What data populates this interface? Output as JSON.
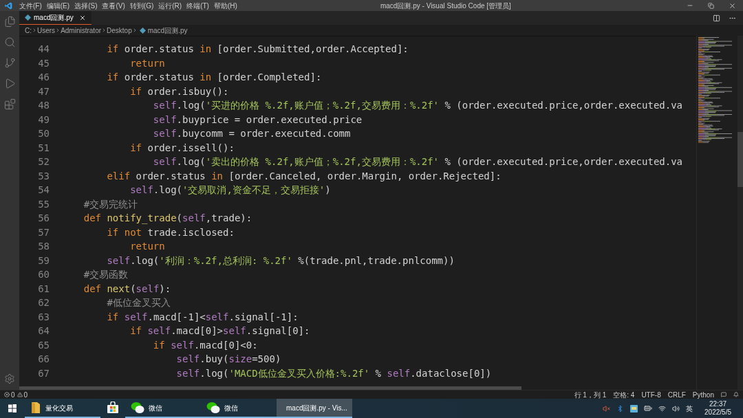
{
  "window": {
    "title": "macd回测.py - Visual Studio Code [管理员]"
  },
  "menu": [
    "文件(F)",
    "编辑(E)",
    "选择(S)",
    "查看(V)",
    "转到(G)",
    "运行(R)",
    "终端(T)",
    "帮助(H)"
  ],
  "tabs": [
    {
      "label": "macd回测.py",
      "selected": true
    }
  ],
  "breadcrumb": [
    "C:",
    "Users",
    "Administrator",
    "Desktop",
    "macd回测.py"
  ],
  "code": {
    "lines": [
      {
        "number": "44",
        "tokens": [
          {
            "kind": "keyword",
            "text": "        if"
          },
          {
            "kind": "plain",
            "text": " order.status "
          },
          {
            "kind": "keyword",
            "text": "in"
          },
          {
            "kind": "plain",
            "text": " [order.Submitted,order.Accepted]:"
          }
        ]
      },
      {
        "number": "45",
        "tokens": [
          {
            "kind": "keyword",
            "text": "            return"
          }
        ]
      },
      {
        "number": "46",
        "tokens": [
          {
            "kind": "keyword",
            "text": "        if"
          },
          {
            "kind": "plain",
            "text": " order.status "
          },
          {
            "kind": "keyword",
            "text": "in"
          },
          {
            "kind": "plain",
            "text": " [order.Completed]:"
          }
        ]
      },
      {
        "number": "47",
        "tokens": [
          {
            "kind": "keyword",
            "text": "            if"
          },
          {
            "kind": "plain",
            "text": " order.isbuy():"
          }
        ]
      },
      {
        "number": "48",
        "tokens": [
          {
            "kind": "self",
            "text": "                self"
          },
          {
            "kind": "plain",
            "text": ".log("
          },
          {
            "kind": "string",
            "text": "'买进的价格 %.2f,账户值；%.2f,交易费用：%.2f'"
          },
          {
            "kind": "plain",
            "text": " % (order.executed.price,order.executed.va"
          }
        ]
      },
      {
        "number": "49",
        "tokens": [
          {
            "kind": "self",
            "text": "                self"
          },
          {
            "kind": "plain",
            "text": ".buyprice = order.executed.price"
          }
        ]
      },
      {
        "number": "50",
        "tokens": [
          {
            "kind": "self",
            "text": "                self"
          },
          {
            "kind": "plain",
            "text": ".buycomm = order.executed.comm"
          }
        ]
      },
      {
        "number": "51",
        "tokens": [
          {
            "kind": "keyword",
            "text": "            if"
          },
          {
            "kind": "plain",
            "text": " order.issell():"
          }
        ]
      },
      {
        "number": "52",
        "tokens": [
          {
            "kind": "self",
            "text": "                self"
          },
          {
            "kind": "plain",
            "text": ".log("
          },
          {
            "kind": "string",
            "text": "'卖出的价格 %.2f,账户值；%.2f,交易费用：%.2f'"
          },
          {
            "kind": "plain",
            "text": " % (order.executed.price,order.executed.va"
          }
        ]
      },
      {
        "number": "53",
        "tokens": [
          {
            "kind": "keyword",
            "text": "        elif"
          },
          {
            "kind": "plain",
            "text": " order.status "
          },
          {
            "kind": "keyword",
            "text": "in"
          },
          {
            "kind": "plain",
            "text": " [order.Canceled, order.Margin, order.Rejected]:"
          }
        ]
      },
      {
        "number": "54",
        "tokens": [
          {
            "kind": "self",
            "text": "            self"
          },
          {
            "kind": "plain",
            "text": ".log("
          },
          {
            "kind": "string",
            "text": "'交易取消,资金不足，交易拒接'"
          },
          {
            "kind": "plain",
            "text": ")"
          }
        ]
      },
      {
        "number": "55",
        "tokens": [
          {
            "kind": "comment",
            "text": "    #交易完统计"
          }
        ]
      },
      {
        "number": "56",
        "tokens": [
          {
            "kind": "keyword",
            "text": "    def"
          },
          {
            "kind": "function",
            "text": " notify_trade"
          },
          {
            "kind": "plain",
            "text": "("
          },
          {
            "kind": "self",
            "text": "self"
          },
          {
            "kind": "plain",
            "text": ",trade):"
          }
        ]
      },
      {
        "number": "57",
        "tokens": [
          {
            "kind": "keyword",
            "text": "        if"
          },
          {
            "kind": "keyword",
            "text": " not"
          },
          {
            "kind": "plain",
            "text": " trade.isclosed:"
          }
        ]
      },
      {
        "number": "58",
        "tokens": [
          {
            "kind": "keyword",
            "text": "            return"
          }
        ]
      },
      {
        "number": "59",
        "tokens": [
          {
            "kind": "self",
            "text": "        self"
          },
          {
            "kind": "plain",
            "text": ".log("
          },
          {
            "kind": "string",
            "text": "'利润：%.2f,总利润: %.2f'"
          },
          {
            "kind": "plain",
            "text": " %(trade.pnl,trade.pnlcomm))"
          }
        ]
      },
      {
        "number": "60",
        "tokens": [
          {
            "kind": "comment",
            "text": "    #交易函数"
          }
        ]
      },
      {
        "number": "61",
        "tokens": [
          {
            "kind": "keyword",
            "text": "    def"
          },
          {
            "kind": "function",
            "text": " next"
          },
          {
            "kind": "plain",
            "text": "("
          },
          {
            "kind": "self",
            "text": "self"
          },
          {
            "kind": "plain",
            "text": "):"
          }
        ]
      },
      {
        "number": "62",
        "tokens": [
          {
            "kind": "comment",
            "text": "        #低位金叉买入"
          }
        ]
      },
      {
        "number": "63",
        "tokens": [
          {
            "kind": "keyword",
            "text": "        if"
          },
          {
            "kind": "self",
            "text": " self"
          },
          {
            "kind": "plain",
            "text": ".macd[-1]<"
          },
          {
            "kind": "self",
            "text": "self"
          },
          {
            "kind": "plain",
            "text": ".signal[-1]:"
          }
        ]
      },
      {
        "number": "64",
        "tokens": [
          {
            "kind": "keyword",
            "text": "            if"
          },
          {
            "kind": "self",
            "text": " self"
          },
          {
            "kind": "plain",
            "text": ".macd[0]>"
          },
          {
            "kind": "self",
            "text": "self"
          },
          {
            "kind": "plain",
            "text": ".signal[0]:"
          }
        ]
      },
      {
        "number": "65",
        "tokens": [
          {
            "kind": "keyword",
            "text": "                if"
          },
          {
            "kind": "self",
            "text": " self"
          },
          {
            "kind": "plain",
            "text": ".macd[0]<0:"
          }
        ]
      },
      {
        "number": "66",
        "tokens": [
          {
            "kind": "self",
            "text": "                    self"
          },
          {
            "kind": "plain",
            "text": ".buy("
          },
          {
            "kind": "param",
            "text": "size"
          },
          {
            "kind": "plain",
            "text": "=500)"
          }
        ]
      },
      {
        "number": "67",
        "tokens": [
          {
            "kind": "self",
            "text": "                    self"
          },
          {
            "kind": "plain",
            "text": ".log("
          },
          {
            "kind": "string",
            "text": "'MACD低位金叉买入价格:%.2f'"
          },
          {
            "kind": "plain",
            "text": " % "
          },
          {
            "kind": "self",
            "text": "self"
          },
          {
            "kind": "plain",
            "text": ".dataclose[0])"
          }
        ]
      }
    ]
  },
  "status_bar": {
    "errors": "0",
    "warnings": "0",
    "items": [
      "行 1，列 1",
      "空格: 4",
      "UTF-8",
      "CRLF",
      "Python"
    ]
  },
  "taskbar": {
    "apps": [
      {
        "kind": "folder",
        "label": "量化交易",
        "running": true,
        "selected": false
      },
      {
        "kind": "store",
        "running": false,
        "selected": false
      },
      {
        "kind": "wechat",
        "label": "微信",
        "running": true,
        "selected": false
      },
      {
        "kind": "wechat",
        "label": "微信",
        "running": true,
        "selected": false
      },
      {
        "kind": "vscode",
        "label": "macd回测.py - Vis...",
        "running": true,
        "selected": true
      }
    ],
    "ime": "英",
    "time": "22:37",
    "date": "2022/5/5"
  }
}
